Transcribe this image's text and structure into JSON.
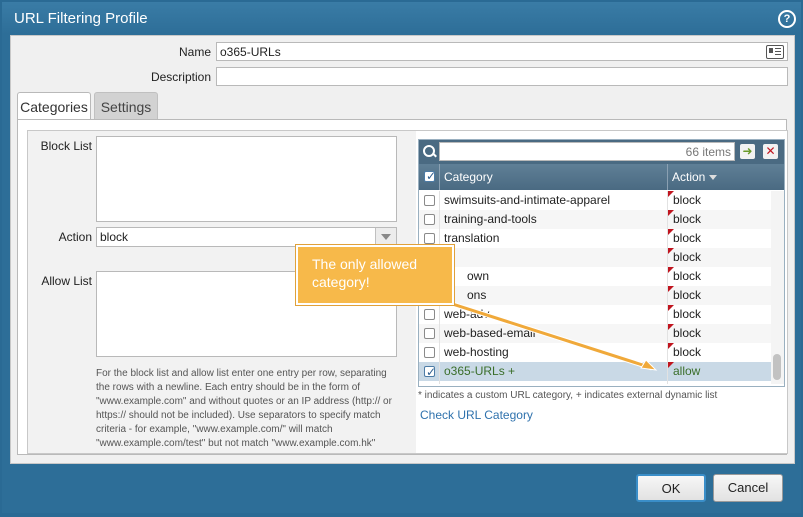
{
  "dialog": {
    "title": "URL Filtering Profile",
    "help_icon": "?"
  },
  "form": {
    "name_label": "Name",
    "name_value": "o365-URLs",
    "description_label": "Description",
    "description_value": ""
  },
  "tabs": [
    {
      "label": "Categories",
      "active": true
    },
    {
      "label": "Settings",
      "active": false
    }
  ],
  "left": {
    "block_list_label": "Block List",
    "action_label": "Action",
    "action_value": "block",
    "allow_list_label": "Allow List",
    "help_text": "For the block list and allow list enter one entry per row, separating the rows with a newline. Each entry should be in the form of \"www.example.com\" and without quotes or an IP address (http:// or https:// should not be included). Use separators to specify match criteria - for example, \"www.example.com/\" will match \"www.example.com/test\" but not match \"www.example.com.hk\""
  },
  "grid": {
    "search_placeholder": "",
    "items_count": "66 items",
    "col_category": "Category",
    "col_action": "Action",
    "rows": [
      {
        "category": "swimsuits-and-intimate-apparel",
        "action": "block"
      },
      {
        "category": "training-and-tools",
        "action": "block"
      },
      {
        "category": "translation",
        "action": "block"
      },
      {
        "category": "",
        "action": "block"
      },
      {
        "category": "own",
        "action": "block"
      },
      {
        "category": "ons",
        "action": "block"
      },
      {
        "category": "web-adv",
        "action": "block"
      },
      {
        "category": "web-based-email",
        "action": "block"
      },
      {
        "category": "web-hosting",
        "action": "block"
      },
      {
        "category": "o365-URLs +",
        "action": "allow"
      }
    ],
    "footnote": "* indicates a custom URL category, + indicates external dynamic list",
    "check_link": "Check URL Category"
  },
  "callout": {
    "text": "The only allowed category!"
  },
  "buttons": {
    "ok": "OK",
    "cancel": "Cancel"
  },
  "colors": {
    "frame": "#2d6e98",
    "callout": "#f7b94a",
    "link": "#2f72ad",
    "allow_text": "#3a6e2a"
  }
}
